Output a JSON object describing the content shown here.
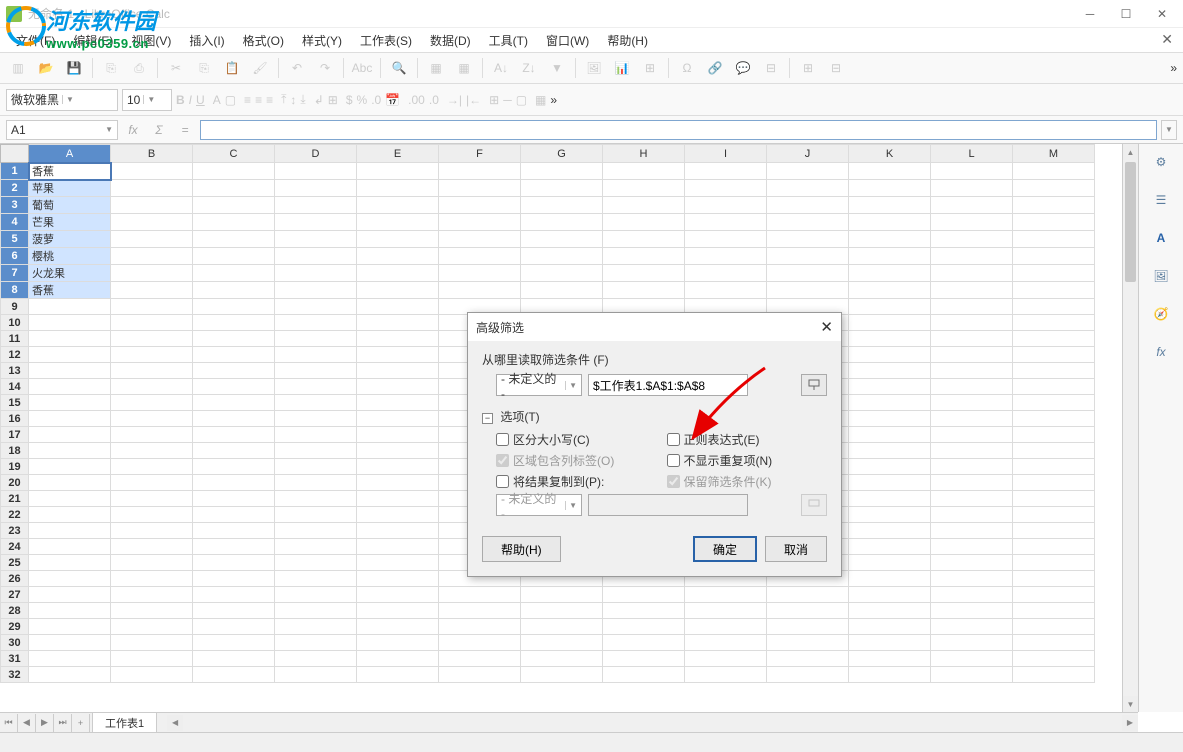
{
  "window": {
    "title": "无命名 1 - LibreOffice Calc"
  },
  "watermark": {
    "brand": "河东软件园",
    "url": "www.pc0359.cn"
  },
  "menu": {
    "file": "文件(F)",
    "edit": "编辑(E)",
    "view": "视图(V)",
    "insert": "插入(I)",
    "format": "格式(O)",
    "styles": "样式(Y)",
    "sheet": "工作表(S)",
    "data": "数据(D)",
    "tools": "工具(T)",
    "window": "窗口(W)",
    "help": "帮助(H)"
  },
  "format": {
    "font": "微软雅黑",
    "size": "10"
  },
  "cellref": "A1",
  "columns": [
    "A",
    "B",
    "C",
    "D",
    "E",
    "F",
    "G",
    "H",
    "I",
    "J",
    "K",
    "L",
    "M"
  ],
  "cells": {
    "A1": "香蕉",
    "A2": "苹果",
    "A3": "葡萄",
    "A4": "芒果",
    "A5": "菠萝",
    "A6": "樱桃",
    "A7": "火龙果",
    "A8": "香蕉"
  },
  "sheet_tab": "工作表1",
  "dialog": {
    "title": "高级筛选",
    "read_from": "从哪里读取筛选条件 (F)",
    "undefined": "- 未定义的 -",
    "range": "$工作表1.$A$1:$A$8",
    "options": "选项(T)",
    "case": "区分大小写(C)",
    "regex": "正则表达式(E)",
    "labels": "区域包含列标签(O)",
    "nodup": "不显示重复项(N)",
    "copyto": "将结果复制到(P):",
    "keep": "保留筛选条件(K)",
    "help": "帮助(H)",
    "ok": "确定",
    "cancel": "取消"
  }
}
